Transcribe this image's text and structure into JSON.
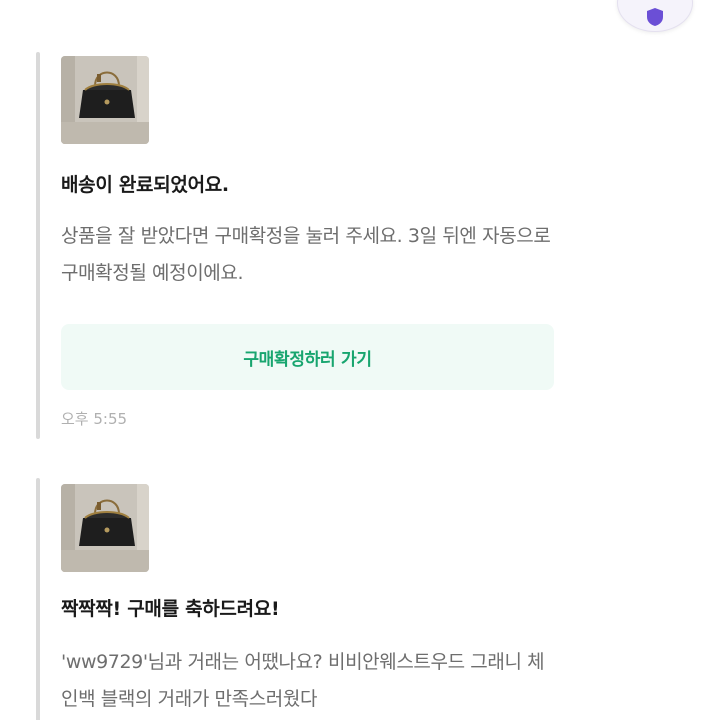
{
  "header": {
    "shield_icon": "shield-icon",
    "accent_color": "#6b4fd6"
  },
  "messages": [
    {
      "title": "배송이 완료되었어요.",
      "body": "상품을 잘 받았다면 구매확정을 눌러 주세요. 3일 뒤엔 자동으로 구매확정될 예정이에요.",
      "button_label": "구매확정하러 가기",
      "time": "오후 5:55"
    },
    {
      "title": "짝짝짝! 구매를 축하드려요!",
      "body": "'ww9729'님과 거래는 어땠나요? 비비안웨스트우드 그래니 체인백 블랙의 거래가 만족스러웠다"
    }
  ],
  "colors": {
    "button_bg": "#f0faf6",
    "button_text": "#18a56f",
    "body_text": "#6e6e6e",
    "title_text": "#1a1a1a"
  }
}
